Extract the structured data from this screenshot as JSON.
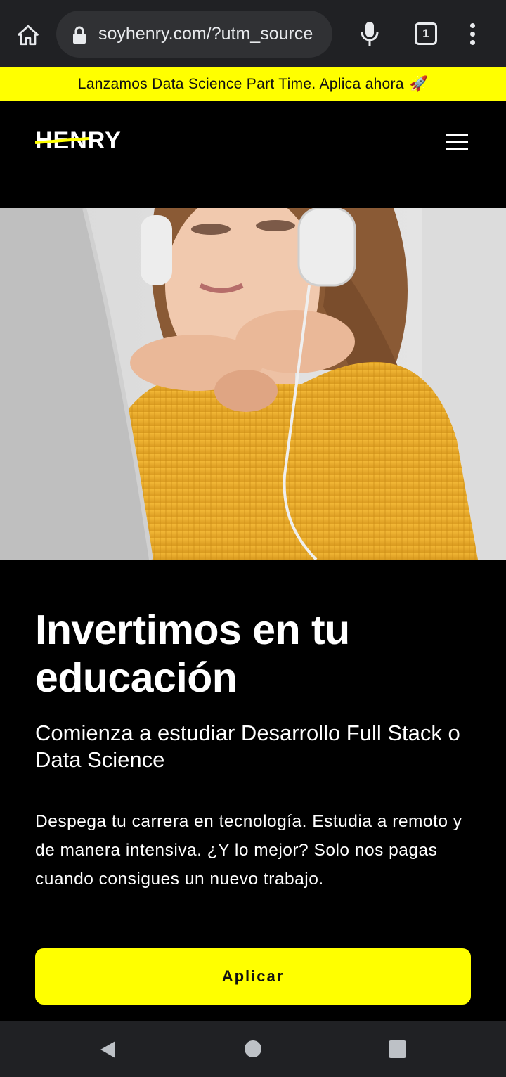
{
  "browser": {
    "url": "soyhenry.com/?utm_source",
    "tab_count": "1",
    "icons": [
      "home-icon",
      "lock-icon",
      "microphone-icon",
      "tab-switcher-icon",
      "more-vert-icon"
    ]
  },
  "banner": {
    "text": "Lanzamos Data Science Part Time. Aplica ahora",
    "emoji": "🚀"
  },
  "header": {
    "logo_text": "HENRY",
    "menu_icon": "hamburger-menu-icon"
  },
  "hero": {
    "image_description_icon": "hero-photo"
  },
  "main": {
    "title": "Invertimos en tu educación",
    "subtitle": "Comienza a estudiar Desarrollo Full Stack o Data Science",
    "description": "Despega tu carrera en tecnología. Estudia a remoto y de manera intensiva. ¿Y lo mejor? Solo nos pagas cuando consigues un nuevo trabajo.",
    "cta_label": "Aplicar"
  },
  "colors": {
    "accent": "#ffff00",
    "background": "#000000",
    "chrome": "#202124"
  },
  "system_nav": {
    "icons": [
      "back-icon",
      "home-circle-icon",
      "recents-icon"
    ]
  }
}
